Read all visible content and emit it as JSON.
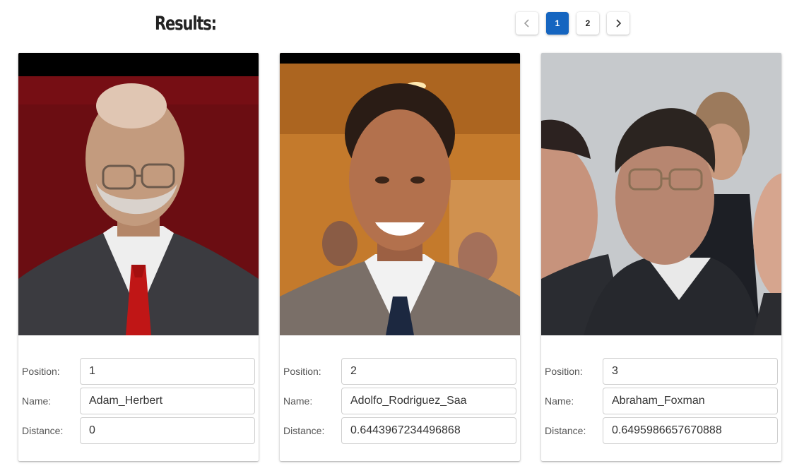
{
  "header": {
    "title": "Results:"
  },
  "pagination": {
    "pages": [
      "1",
      "2"
    ],
    "current": "1"
  },
  "labels": {
    "position": "Position:",
    "name": "Name:",
    "distance": "Distance:"
  },
  "results": [
    {
      "position": "1",
      "name": "Adam_Herbert",
      "distance": "0"
    },
    {
      "position": "2",
      "name": "Adolfo_Rodriguez_Saa",
      "distance": "0.6443967234496868"
    },
    {
      "position": "3",
      "name": "Abraham_Foxman",
      "distance": "0.6495986657670888"
    }
  ],
  "colors": {
    "accent": "#1565c0"
  }
}
